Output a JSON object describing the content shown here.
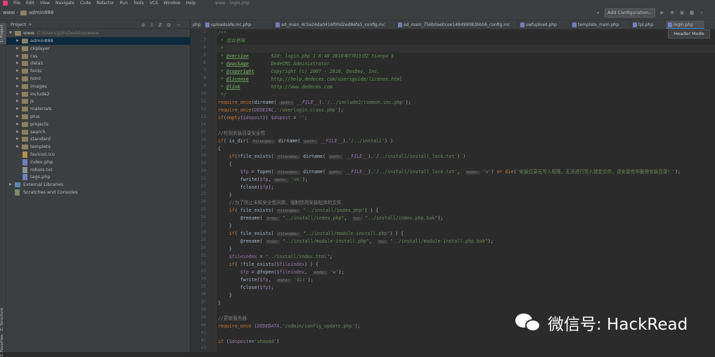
{
  "menu": {
    "items": [
      "File",
      "Edit",
      "View",
      "Navigate",
      "Code",
      "Refactor",
      "Run",
      "Tools",
      "VCS",
      "Window",
      "Help"
    ],
    "window_title": "www - login.php"
  },
  "nav": {
    "breadcrumb_root": "www",
    "breadcrumb_dir": "admin888",
    "add_configuration": "Add Configuration..."
  },
  "project": {
    "title": "Project",
    "root": {
      "name": "www",
      "path": "C:\\Users\\jizh\\Desktop\\www"
    },
    "items": [
      {
        "name": "admin888",
        "kind": "folder"
      },
      {
        "name": "ckplayer",
        "kind": "folder"
      },
      {
        "name": "css",
        "kind": "folder"
      },
      {
        "name": "data1",
        "kind": "folder"
      },
      {
        "name": "fonts",
        "kind": "folder"
      },
      {
        "name": "html",
        "kind": "folder"
      },
      {
        "name": "images",
        "kind": "folder"
      },
      {
        "name": "include2",
        "kind": "folder"
      },
      {
        "name": "js",
        "kind": "folder"
      },
      {
        "name": "materials",
        "kind": "folder"
      },
      {
        "name": "plus",
        "kind": "folder"
      },
      {
        "name": "projects",
        "kind": "folder"
      },
      {
        "name": "search",
        "kind": "folder"
      },
      {
        "name": "standard",
        "kind": "folder"
      },
      {
        "name": "templets",
        "kind": "folder"
      },
      {
        "name": "favicon.ico",
        "kind": "ico"
      },
      {
        "name": "index.php",
        "kind": "php"
      },
      {
        "name": "robots.txt",
        "kind": "txt"
      },
      {
        "name": "tags.php",
        "kind": "php"
      }
    ],
    "external_libraries": "External Libraries",
    "scratches": "Scratches and Consoles",
    "side_tabs": {
      "project": "1: Project",
      "structure": "Z: Structure",
      "favorites": "2: Favorites"
    }
  },
  "tabs": [
    {
      "label": "php"
    },
    {
      "label": "uploadsafe.inc.php"
    },
    {
      "label": "ad_main_4c5a24da0416f00d2ed8efa5_config.inc"
    },
    {
      "label": "ad_main_756b0ae0cee148499082bb56_config.inc"
    },
    {
      "label": "swfupload.php"
    },
    {
      "label": "template_main.php"
    },
    {
      "label": "tpl.php"
    },
    {
      "label": "login.php"
    }
  ],
  "tooltip": "Header Mode",
  "code": {
    "line_numbers": [
      "2",
      "3",
      "4",
      "5",
      "6",
      "7",
      "8",
      "9",
      "10",
      "11",
      "12",
      "13",
      "14",
      "15",
      "16",
      "17",
      "18",
      "19",
      "20",
      "21",
      "22",
      "23",
      "24",
      "25",
      "26",
      "27",
      "28",
      "29",
      "30",
      "31",
      "32",
      "33",
      "34",
      "35",
      "36",
      "37",
      "38",
      "39",
      "40",
      "41",
      "42",
      "43"
    ],
    "lines": [
      "/**",
      " * 后台登陆",
      " *",
      " * @version        $Id: login.php 1 8:48 2010年7月13日Z tianya $",
      " * @package        DedeCMS.Administrator",
      " * @copyright      Copyright (c) 2007 - 2010, DesDev, Inc.",
      " * @license        http://help.dedecms.com/usersguide/license.html",
      " * @link           http://www.dedecms.com",
      " */",
      "require_once(dirname( path: __FILE__).'/../include2/common.inc.php');",
      "require_once(DEDEINC.'/userlogin.class.php');",
      "if(empty($dopost)) $dopost = '';",
      "",
      "//检测安装目录安全性",
      "if( is_dir( filename: dirname( path: __FILE__).'/../install') )",
      "{",
      "    if(!file_exists( filename: dirname( path: __FILE__).'/../install/install_lock.txt') )",
      "    {",
      "        $fp = fopen( filename: dirname( path: __FILE__).'/../install/install_lock.txt',  mode: 'w') or die('安装目录无写入权限，无法进行写入锁定文件，请安装完毕删除安装目录！');",
      "        fwrite($fp, data: 'ok');",
      "        fclose($fp);",
      "    }",
      "    //为了防止未知安全性问题，强制禁用安装程序的文件",
      "    if( file_exists( filename: \"../install/index.php\") ) {",
      "        @rename( from: \"../install/index.php\",  to: \"../install/index.php.bak\");",
      "    }",
      "    if( file_exists( filename: \"../install/module-install.php\") ) {",
      "        @rename( from: \"../install/module-install.php\",  to: \"../install/module-install.php.bak\");",
      "    }",
      "    $fileindex = \"../install/index.html\";",
      "    if( !file_exists($fileindex) ) {",
      "        $fp = @fopen($fileindex,  mode: 'w');",
      "        fwrite($fp,  data: 'dir');",
      "        fclose($fp);",
      "    }",
      "}",
      "",
      "//更新服务器",
      "require_once (DEDEDATA.'/admin/config_update.php');",
      "",
      "if ($dopost=='showad')"
    ]
  },
  "watermark": {
    "text": "微信号: HackRead",
    "icon": "wechat-icon"
  }
}
